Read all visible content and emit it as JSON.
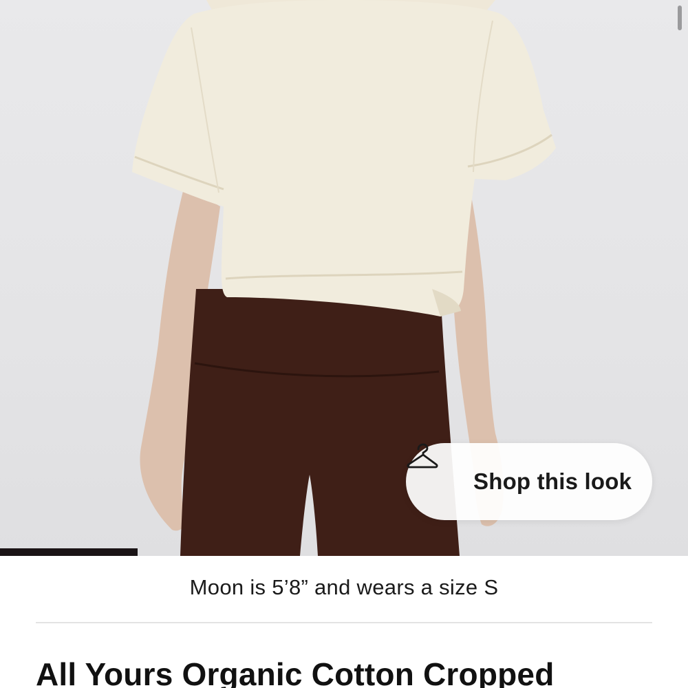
{
  "product_image": {
    "icon": "product-photo",
    "gallery_progress": 0.2
  },
  "shop_look": {
    "label": "Shop this look",
    "icon": "hanger-icon"
  },
  "model_info": {
    "text": "Moon is 5’8” and wears a size S"
  },
  "product": {
    "title": "All Yours Organic Cotton Cropped"
  },
  "colors": {
    "progress_fill": "#1a1416",
    "photo_background": "#e6e6e8",
    "shirt": "#f1ecdd",
    "leggings": "#3f1f17"
  }
}
